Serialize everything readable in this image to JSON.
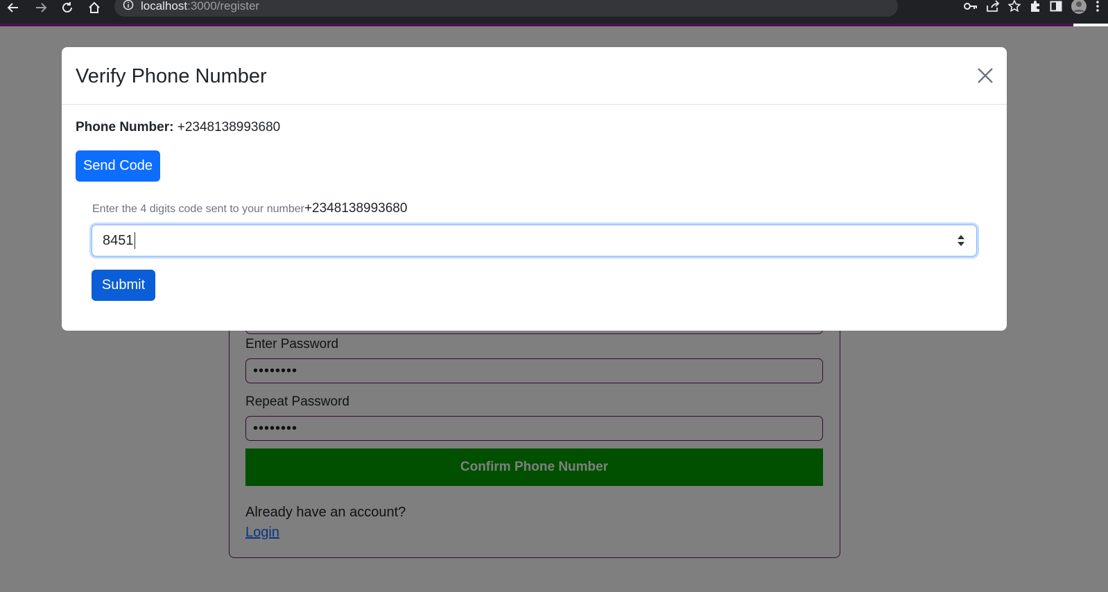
{
  "browser": {
    "url_host": "localhost",
    "url_path": ":3000/register"
  },
  "modal": {
    "title": "Verify Phone Number",
    "phone_label": "Phone Number:",
    "phone_value": "+2348138993680",
    "send_code_label": "Send Code",
    "help_text": "Enter the 4 digits code sent to your number",
    "help_number": "+2348138993680",
    "code_value": "8451",
    "submit_label": "Submit"
  },
  "register_form": {
    "password_label": "Enter Password",
    "password_value": "••••••••",
    "repeat_label": "Repeat Password",
    "repeat_value": "••••••••",
    "confirm_label": "Confirm Phone Number",
    "already_text": "Already have an account?",
    "login_link": "Login"
  }
}
